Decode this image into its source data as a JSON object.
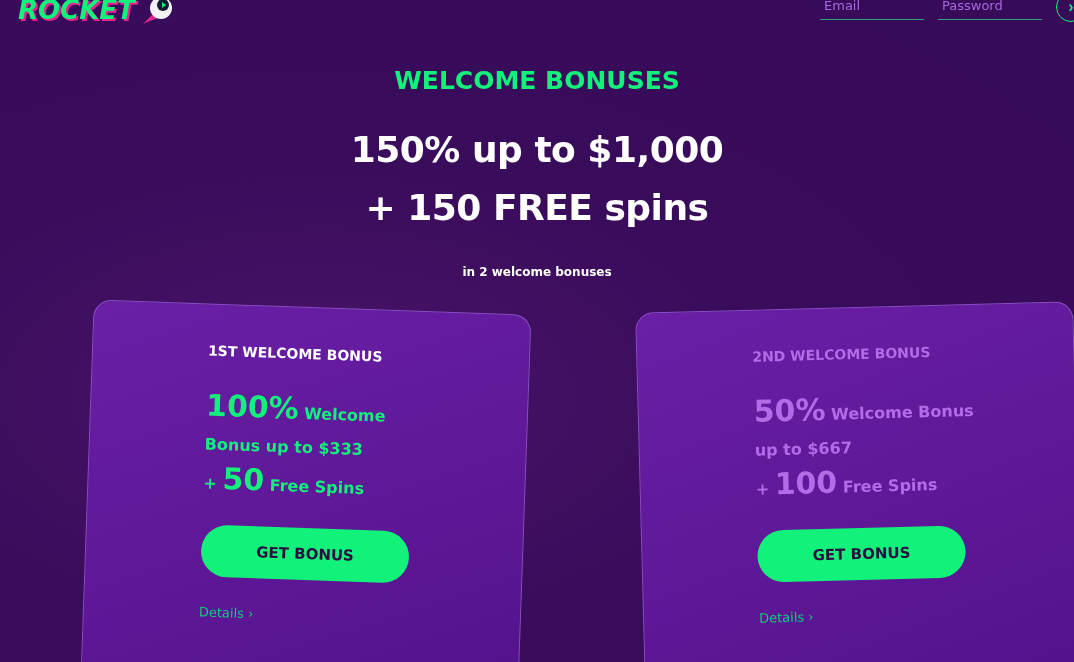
{
  "header": {
    "logo": "ROCKET",
    "email": {
      "placeholder": "Email"
    },
    "password": {
      "placeholder": "Password"
    },
    "submit": "›"
  },
  "hero": {
    "kicker": "WELCOME BONUSES",
    "headline_1": "150% up to $1,000",
    "headline_2": "+ 150 FREE spins",
    "note": "in 2 welcome bonuses"
  },
  "cards": [
    {
      "title": "1ST WELCOME BONUS",
      "active": true,
      "percent": "100%",
      "after_percent": "Welcome",
      "line_2": "Bonus up to $333",
      "plus": "+",
      "spins": "50",
      "spins_label": "Free Spins",
      "button": "GET BONUS",
      "details": "Details ›"
    },
    {
      "title": "2ND WELCOME BONUS",
      "active": false,
      "percent": "50%",
      "after_percent": "Welcome Bonus",
      "line_2": "up to $667",
      "plus": "+",
      "spins": "100",
      "spins_label": "Free Spins",
      "button": "GET BONUS",
      "details": "Details ›"
    }
  ]
}
